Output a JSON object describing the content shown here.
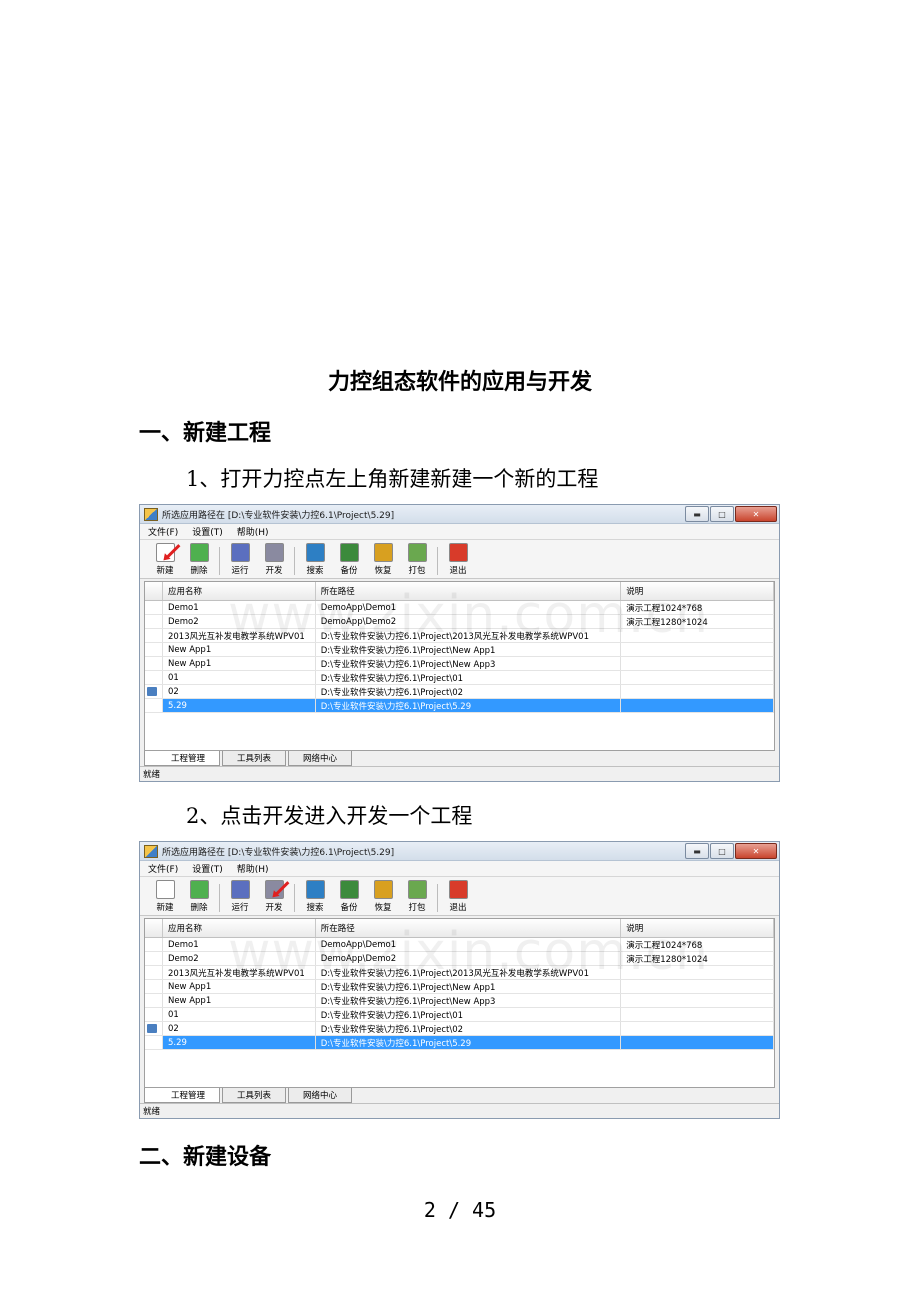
{
  "doc": {
    "title": "力控组态软件的应用与开发",
    "section1": "一、新建工程",
    "step1": "1、打开力控点左上角新建新建一个新的工程",
    "step2": "2、点击开发进入开发一个工程",
    "section2": "二、新建设备",
    "page": "2 / 45"
  },
  "window": {
    "title": "所选应用路径在 [D:\\专业软件安装\\力控6.1\\Project\\5.29]",
    "watermark": "www.zixin.com.cn",
    "menu": [
      "文件(F)",
      "设置(T)",
      "帮助(H)"
    ],
    "tools": [
      {
        "label": "新建",
        "icon": "new-icon",
        "color": "#ffffff"
      },
      {
        "label": "删除",
        "icon": "delete-icon",
        "color": "#4fb04f"
      },
      {
        "label": "运行",
        "icon": "run-icon",
        "color": "#5b6fbf"
      },
      {
        "label": "开发",
        "icon": "develop-icon",
        "color": "#8a8aa0"
      },
      {
        "label": "搜索",
        "icon": "search-icon",
        "color": "#2d7fc4"
      },
      {
        "label": "备份",
        "icon": "backup-icon",
        "color": "#3c8a3c"
      },
      {
        "label": "恢复",
        "icon": "restore-icon",
        "color": "#d8a020"
      },
      {
        "label": "打包",
        "icon": "package-icon",
        "color": "#6aa84f"
      },
      {
        "label": "退出",
        "icon": "exit-icon",
        "color": "#d83b2a"
      }
    ],
    "columns": [
      "应用名称",
      "所在路径",
      "说明"
    ],
    "rows": [
      [
        "Demo1",
        "DemoApp\\Demo1",
        "演示工程1024*768"
      ],
      [
        "Demo2",
        "DemoApp\\Demo2",
        "演示工程1280*1024"
      ],
      [
        "2013风光互补发电教学系统WPV01",
        "D:\\专业软件安装\\力控6.1\\Project\\2013风光互补发电教学系统WPV01",
        ""
      ],
      [
        "New App1",
        "D:\\专业软件安装\\力控6.1\\Project\\New App1",
        ""
      ],
      [
        "New App1",
        "D:\\专业软件安装\\力控6.1\\Project\\New App3",
        ""
      ],
      [
        "01",
        "D:\\专业软件安装\\力控6.1\\Project\\01",
        ""
      ],
      [
        "02",
        "D:\\专业软件安装\\力控6.1\\Project\\02",
        ""
      ],
      [
        "5.29",
        "D:\\专业软件安装\\力控6.1\\Project\\5.29",
        ""
      ]
    ],
    "tabs": [
      "工程管理",
      "工具列表",
      "网络中心"
    ],
    "status": "就绪"
  }
}
